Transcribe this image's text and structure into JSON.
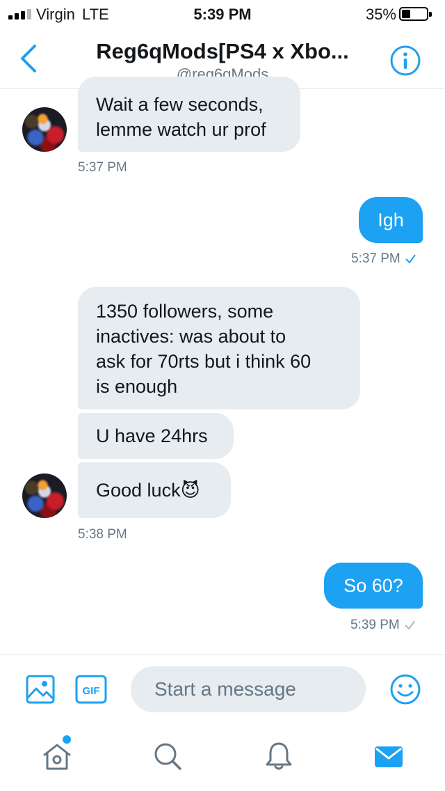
{
  "status_bar": {
    "carrier": "Virgin",
    "network": "LTE",
    "time": "5:39 PM",
    "battery_percent": "35%",
    "signal_bars_filled": 3,
    "signal_bars_total": 4,
    "battery_level": 0.35
  },
  "header": {
    "title": "Reg6qMods[PS4 x Xbo...",
    "handle": "@reg6qMods"
  },
  "messages": [
    {
      "direction": "incoming",
      "text": "Wait a few seconds,\nlemme watch ur prof"
    },
    {
      "direction": "incoming",
      "timestamp": "5:37 PM"
    },
    {
      "direction": "outgoing",
      "text": "Igh"
    },
    {
      "direction": "outgoing",
      "timestamp": "5:37 PM",
      "status": "read",
      "status_icon": "checkmark-icon"
    },
    {
      "direction": "incoming",
      "text": "1350 followers, some\ninactives: was about to\nask for 70rts but i think 60\nis enough"
    },
    {
      "direction": "incoming",
      "text": "U have 24hrs"
    },
    {
      "direction": "incoming",
      "text": "Good luck",
      "emoji": "😈"
    },
    {
      "direction": "incoming",
      "timestamp": "5:38 PM"
    },
    {
      "direction": "outgoing",
      "text": "So 60?"
    },
    {
      "direction": "outgoing",
      "timestamp": "5:39 PM",
      "status": "sent",
      "status_icon": "checkmark-icon"
    }
  ],
  "composer": {
    "placeholder": "Start a message",
    "gif_label": "GIF"
  },
  "tabs": [
    {
      "name": "home",
      "icon": "home-icon",
      "has_notification_dot": true
    },
    {
      "name": "search",
      "icon": "search-icon"
    },
    {
      "name": "notifications",
      "icon": "bell-icon"
    },
    {
      "name": "messages",
      "icon": "envelope-icon",
      "active": true
    }
  ],
  "colors": {
    "accent": "#1da1f2",
    "incoming_bubble": "#e6ecf0",
    "secondary_text": "#657786",
    "read_check": "#1da1f2",
    "sent_check": "#aab8c2",
    "inactive_icon": "#657786"
  }
}
